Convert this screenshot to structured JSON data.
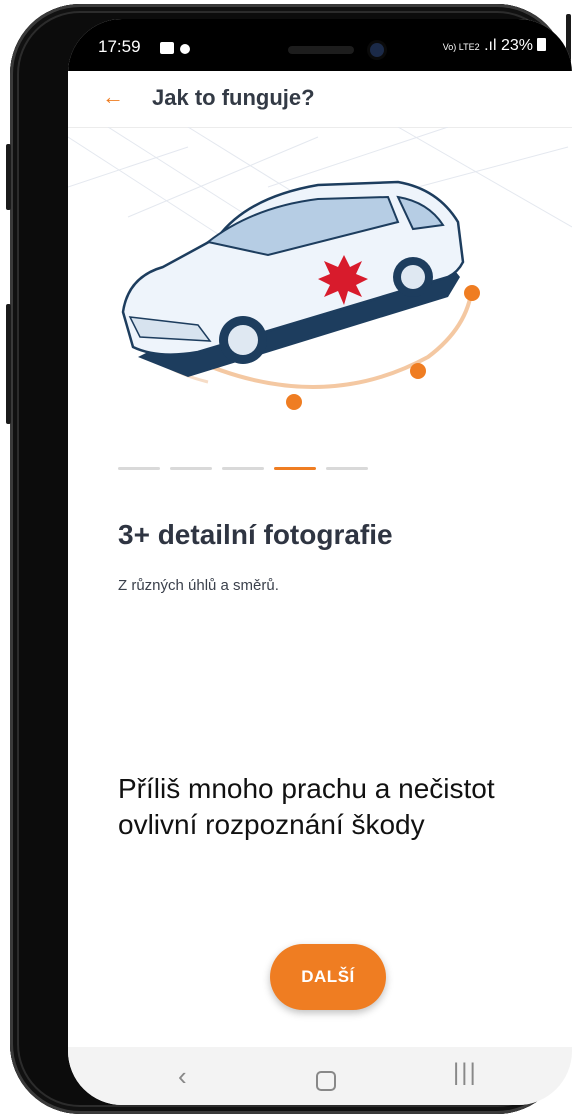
{
  "status_bar": {
    "time": "17:59",
    "network": "Vo) LTE2",
    "battery": "23%"
  },
  "header": {
    "back_icon": "arrow-left-icon",
    "title": "Jak to funguje?"
  },
  "illustration": {
    "icon": "car-damage-illustration",
    "damage_color": "#d81b2c",
    "accent_color": "#ef7d22"
  },
  "pager": {
    "count": 5,
    "active_index": 3
  },
  "slide": {
    "title": "3+ detailní fotografie",
    "subtitle": "Z různých úhlů a směrů."
  },
  "tip": {
    "text": "Příliš mnoho prachu a nečistot ovlivní rozpoznání škody"
  },
  "actions": {
    "next_label": "DALŠÍ"
  },
  "system_nav": {
    "back": "‹",
    "home": "",
    "recent": "|||"
  }
}
